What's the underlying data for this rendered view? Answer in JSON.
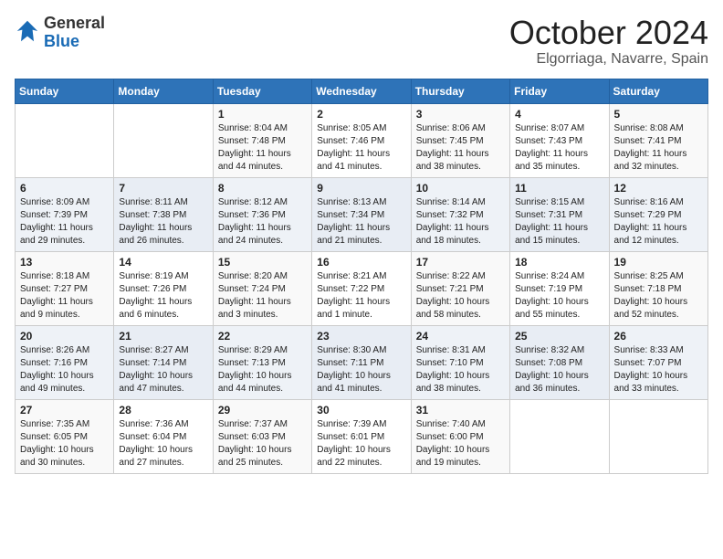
{
  "header": {
    "logo_general": "General",
    "logo_blue": "Blue",
    "month_title": "October 2024",
    "location": "Elgorriaga, Navarre, Spain"
  },
  "weekdays": [
    "Sunday",
    "Monday",
    "Tuesday",
    "Wednesday",
    "Thursday",
    "Friday",
    "Saturday"
  ],
  "weeks": [
    [
      {
        "day": "",
        "sunrise": "",
        "sunset": "",
        "daylight": ""
      },
      {
        "day": "",
        "sunrise": "",
        "sunset": "",
        "daylight": ""
      },
      {
        "day": "1",
        "sunrise": "Sunrise: 8:04 AM",
        "sunset": "Sunset: 7:48 PM",
        "daylight": "Daylight: 11 hours and 44 minutes."
      },
      {
        "day": "2",
        "sunrise": "Sunrise: 8:05 AM",
        "sunset": "Sunset: 7:46 PM",
        "daylight": "Daylight: 11 hours and 41 minutes."
      },
      {
        "day": "3",
        "sunrise": "Sunrise: 8:06 AM",
        "sunset": "Sunset: 7:45 PM",
        "daylight": "Daylight: 11 hours and 38 minutes."
      },
      {
        "day": "4",
        "sunrise": "Sunrise: 8:07 AM",
        "sunset": "Sunset: 7:43 PM",
        "daylight": "Daylight: 11 hours and 35 minutes."
      },
      {
        "day": "5",
        "sunrise": "Sunrise: 8:08 AM",
        "sunset": "Sunset: 7:41 PM",
        "daylight": "Daylight: 11 hours and 32 minutes."
      }
    ],
    [
      {
        "day": "6",
        "sunrise": "Sunrise: 8:09 AM",
        "sunset": "Sunset: 7:39 PM",
        "daylight": "Daylight: 11 hours and 29 minutes."
      },
      {
        "day": "7",
        "sunrise": "Sunrise: 8:11 AM",
        "sunset": "Sunset: 7:38 PM",
        "daylight": "Daylight: 11 hours and 26 minutes."
      },
      {
        "day": "8",
        "sunrise": "Sunrise: 8:12 AM",
        "sunset": "Sunset: 7:36 PM",
        "daylight": "Daylight: 11 hours and 24 minutes."
      },
      {
        "day": "9",
        "sunrise": "Sunrise: 8:13 AM",
        "sunset": "Sunset: 7:34 PM",
        "daylight": "Daylight: 11 hours and 21 minutes."
      },
      {
        "day": "10",
        "sunrise": "Sunrise: 8:14 AM",
        "sunset": "Sunset: 7:32 PM",
        "daylight": "Daylight: 11 hours and 18 minutes."
      },
      {
        "day": "11",
        "sunrise": "Sunrise: 8:15 AM",
        "sunset": "Sunset: 7:31 PM",
        "daylight": "Daylight: 11 hours and 15 minutes."
      },
      {
        "day": "12",
        "sunrise": "Sunrise: 8:16 AM",
        "sunset": "Sunset: 7:29 PM",
        "daylight": "Daylight: 11 hours and 12 minutes."
      }
    ],
    [
      {
        "day": "13",
        "sunrise": "Sunrise: 8:18 AM",
        "sunset": "Sunset: 7:27 PM",
        "daylight": "Daylight: 11 hours and 9 minutes."
      },
      {
        "day": "14",
        "sunrise": "Sunrise: 8:19 AM",
        "sunset": "Sunset: 7:26 PM",
        "daylight": "Daylight: 11 hours and 6 minutes."
      },
      {
        "day": "15",
        "sunrise": "Sunrise: 8:20 AM",
        "sunset": "Sunset: 7:24 PM",
        "daylight": "Daylight: 11 hours and 3 minutes."
      },
      {
        "day": "16",
        "sunrise": "Sunrise: 8:21 AM",
        "sunset": "Sunset: 7:22 PM",
        "daylight": "Daylight: 11 hours and 1 minute."
      },
      {
        "day": "17",
        "sunrise": "Sunrise: 8:22 AM",
        "sunset": "Sunset: 7:21 PM",
        "daylight": "Daylight: 10 hours and 58 minutes."
      },
      {
        "day": "18",
        "sunrise": "Sunrise: 8:24 AM",
        "sunset": "Sunset: 7:19 PM",
        "daylight": "Daylight: 10 hours and 55 minutes."
      },
      {
        "day": "19",
        "sunrise": "Sunrise: 8:25 AM",
        "sunset": "Sunset: 7:18 PM",
        "daylight": "Daylight: 10 hours and 52 minutes."
      }
    ],
    [
      {
        "day": "20",
        "sunrise": "Sunrise: 8:26 AM",
        "sunset": "Sunset: 7:16 PM",
        "daylight": "Daylight: 10 hours and 49 minutes."
      },
      {
        "day": "21",
        "sunrise": "Sunrise: 8:27 AM",
        "sunset": "Sunset: 7:14 PM",
        "daylight": "Daylight: 10 hours and 47 minutes."
      },
      {
        "day": "22",
        "sunrise": "Sunrise: 8:29 AM",
        "sunset": "Sunset: 7:13 PM",
        "daylight": "Daylight: 10 hours and 44 minutes."
      },
      {
        "day": "23",
        "sunrise": "Sunrise: 8:30 AM",
        "sunset": "Sunset: 7:11 PM",
        "daylight": "Daylight: 10 hours and 41 minutes."
      },
      {
        "day": "24",
        "sunrise": "Sunrise: 8:31 AM",
        "sunset": "Sunset: 7:10 PM",
        "daylight": "Daylight: 10 hours and 38 minutes."
      },
      {
        "day": "25",
        "sunrise": "Sunrise: 8:32 AM",
        "sunset": "Sunset: 7:08 PM",
        "daylight": "Daylight: 10 hours and 36 minutes."
      },
      {
        "day": "26",
        "sunrise": "Sunrise: 8:33 AM",
        "sunset": "Sunset: 7:07 PM",
        "daylight": "Daylight: 10 hours and 33 minutes."
      }
    ],
    [
      {
        "day": "27",
        "sunrise": "Sunrise: 7:35 AM",
        "sunset": "Sunset: 6:05 PM",
        "daylight": "Daylight: 10 hours and 30 minutes."
      },
      {
        "day": "28",
        "sunrise": "Sunrise: 7:36 AM",
        "sunset": "Sunset: 6:04 PM",
        "daylight": "Daylight: 10 hours and 27 minutes."
      },
      {
        "day": "29",
        "sunrise": "Sunrise: 7:37 AM",
        "sunset": "Sunset: 6:03 PM",
        "daylight": "Daylight: 10 hours and 25 minutes."
      },
      {
        "day": "30",
        "sunrise": "Sunrise: 7:39 AM",
        "sunset": "Sunset: 6:01 PM",
        "daylight": "Daylight: 10 hours and 22 minutes."
      },
      {
        "day": "31",
        "sunrise": "Sunrise: 7:40 AM",
        "sunset": "Sunset: 6:00 PM",
        "daylight": "Daylight: 10 hours and 19 minutes."
      },
      {
        "day": "",
        "sunrise": "",
        "sunset": "",
        "daylight": ""
      },
      {
        "day": "",
        "sunrise": "",
        "sunset": "",
        "daylight": ""
      }
    ]
  ]
}
